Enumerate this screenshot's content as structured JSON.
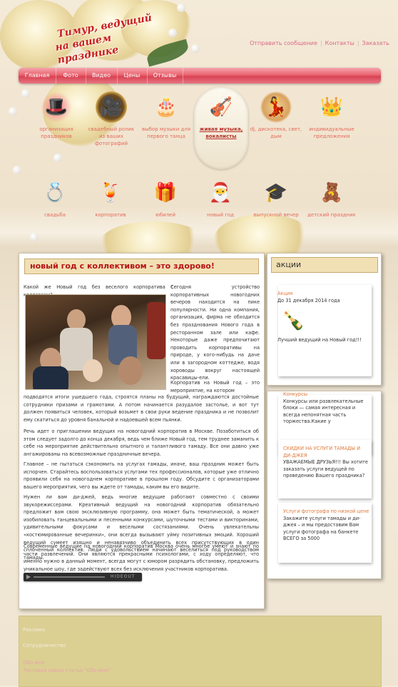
{
  "header": {
    "logo_line1": "Тимур, ведущий",
    "logo_line2": "на вашем празднике",
    "links": [
      "Отправить сообщение",
      "Контакты",
      "Заказать"
    ]
  },
  "nav": [
    "Главная",
    "Фото",
    "Видео",
    "Цены",
    "Отзывы"
  ],
  "services_row1": [
    {
      "icon": "magic-hat-icon",
      "glyph": "🎩",
      "label": "организация праздников"
    },
    {
      "icon": "film-camera-icon",
      "glyph": "🎥",
      "label": "свадебный ролик из ваших фотографий"
    },
    {
      "icon": "wedding-cake-icon",
      "glyph": "🎂",
      "label": "выбор музыки для первого танца"
    },
    {
      "icon": "violin-icon",
      "glyph": "🎻",
      "label": "живая музыка, вокалисты"
    },
    {
      "icon": "dj-icon",
      "glyph": "💃",
      "label": "dj, дискотека, свет, дым"
    },
    {
      "icon": "crown-icon",
      "glyph": "👑",
      "label": "индивидуальные предложения"
    }
  ],
  "services_row2": [
    {
      "icon": "wedding-rings-icon",
      "glyph": "💍",
      "label": "свадьба"
    },
    {
      "icon": "cocktail-icon",
      "glyph": "🍹",
      "label": "корпоратив"
    },
    {
      "icon": "gift-basket-icon",
      "glyph": "🎁",
      "label": "юбилей"
    },
    {
      "icon": "santa-icon",
      "glyph": "🎅",
      "label": "новый год"
    },
    {
      "icon": "graduation-cap-icon",
      "glyph": "🎓",
      "label": "выпускной вечер"
    },
    {
      "icon": "teddy-bear-icon",
      "glyph": "🧸",
      "label": "детский праздник"
    }
  ],
  "article": {
    "title": "новый год с коллективом – это здорово!",
    "p_intro": "Какой же Новый год без веселого корпоратива с коллегами?",
    "p_float": "Сегодня устройство корпоративных новогодних вечеров находится на пике популярности. Ни одна компания, организация, фирма не обходится без празднования Нового года в ресторанном зале или кафе. Некоторые даже предпочитают проводить корпоративы на природе, у кого-нибудь на даче или в загородном коттедже, водя хороводы вокруг настоящей красавицы-ели.",
    "p_float2": "Корпоратив на Новый год – это мероприятие, на котором",
    "p1": "подводятся итоги ушедшего года, строятся планы на будущий, награждаются достойные сотрудники призами и грамотами. А потом начинается разудалое застолье, и вот тут должен появиться человек, который возьмет в свои руки ведение праздника и не позволит ему скатиться до уровня банальной и надоевшей всем пьянки.",
    "p2": "Речь идет о приглашении ведущих на новогодний корпоратив в Москве. Позаботиться об этом следует задолго до конца декабря, ведь чем ближе Новый год, тем труднее заманить к себе на мероприятие действительно опытного и талантливого тамаду. Все они давно уже ангажированы на всевозможные праздничные вечера.",
    "p3": "Главное – не пытаться сэкономить на услугах тамады, иначе, ваш праздник может быть испорчен. Старайтесь воспользоваться услугами тех профессионалов, которые уже отлично проявили себя на новогоднем корпоративе в прошлом году. Обсудите с организаторами вашего мероприятия, чего вы ждете от тамады, каким вы его видите.",
    "p4": "Нужен ли вам ди-джей, ведь многие ведущие работают совместно с своими звукорежиссерами. Креативный ведущий на новогодний корпоратив обязательно предложит вам свою эксклюзивную программу, она может быть тематической, а может изобиловать танцевальными и песенными конкурсами, шуточными тестами и викторинами, удивительными фокусами и веселыми состязаниями. Очень увлекательны «костюмированные вечеринки», они всегда вызывают уйму позитивных эмоций. Хороший ведущий сумеет изящно и ненавязчиво объединить всех присутствующих в один сплоченный коллектив. Люди с удовольствием начинают веселиться под руководством тамады.",
    "p5": "Современные ведущие на новогодний корпоратив Москва очень многое умеют и знают по части развлечений. Они являются прекрасными психологами, с ходу определяют, что именно нужно в данный момент, всегда могут с юмором разрядить обстановку, предложить уникальное шоу, где задействуют всех без исключения участников корпоратива.",
    "player_label": "HIDEOUT"
  },
  "sidebar": {
    "title": "акции",
    "promo_label": "Акция",
    "promo_date": "До 31 декабря 2014 года",
    "promo_caption": "Лучший ведущий на Новый год!!!",
    "news": [
      {
        "title": "Конкурсы",
        "body": "Конкурсы или развлекательные блоки — самая интересная и всегда непонятная часть торжества.Какие у"
      },
      {
        "title": "СКИДКИ НА УСЛУГИ ТАМАДЫ И ДИ-ДЖЕЯ",
        "body": "УВАЖАЕМЫЕ ДРУЗЬЯ!!! Вы хотите заказать услуги ведущей по проведению Вашего праздника?"
      },
      {
        "title": "Услуги фотографа по низкой цене",
        "body": "Закажите услуги тамады и ди-джея – и мы предоставим Вам услуги фотографа на банкете ВСЕГО за 5000"
      }
    ]
  },
  "footer": [
    "Реклама",
    "Сотрудничество",
    "Обо мне",
    "Тестовая новая статья \"Обо мне\""
  ]
}
